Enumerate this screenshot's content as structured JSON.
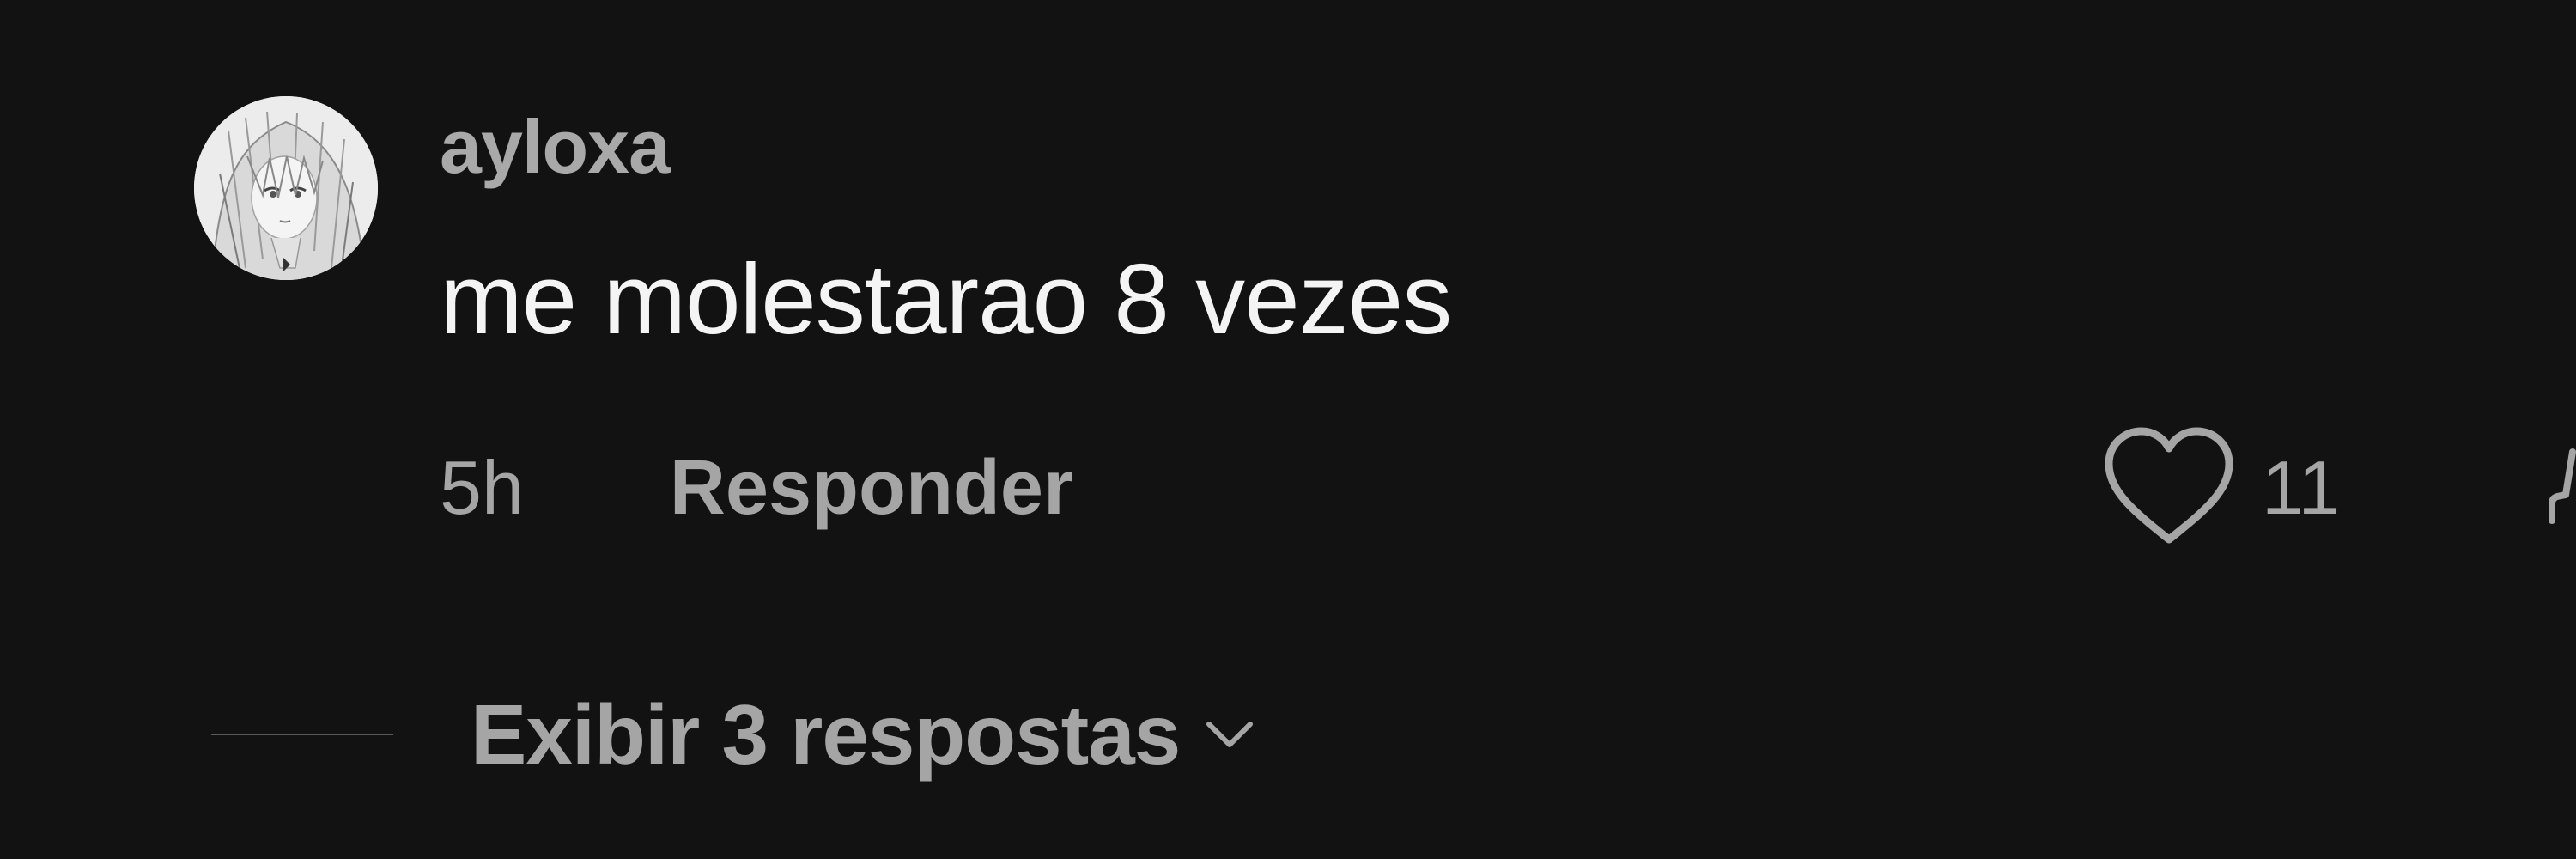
{
  "comment": {
    "username": "ayloxa",
    "text": "me molestarao 8 vezes",
    "timestamp": "5h",
    "reply_label": "Responder",
    "like_count": "11",
    "avatar_icon": "user-avatar-manga-portrait",
    "like_icon": "heart-outline-icon",
    "dislike_icon": "dislike-icon"
  },
  "replies": {
    "label": "Exibir 3 respostas",
    "icon": "chevron-down-icon"
  },
  "colors": {
    "background": "#121212",
    "primary_text": "#f4f4f4",
    "secondary_text": "#a5a5a5",
    "divider": "#5a5a5a"
  }
}
